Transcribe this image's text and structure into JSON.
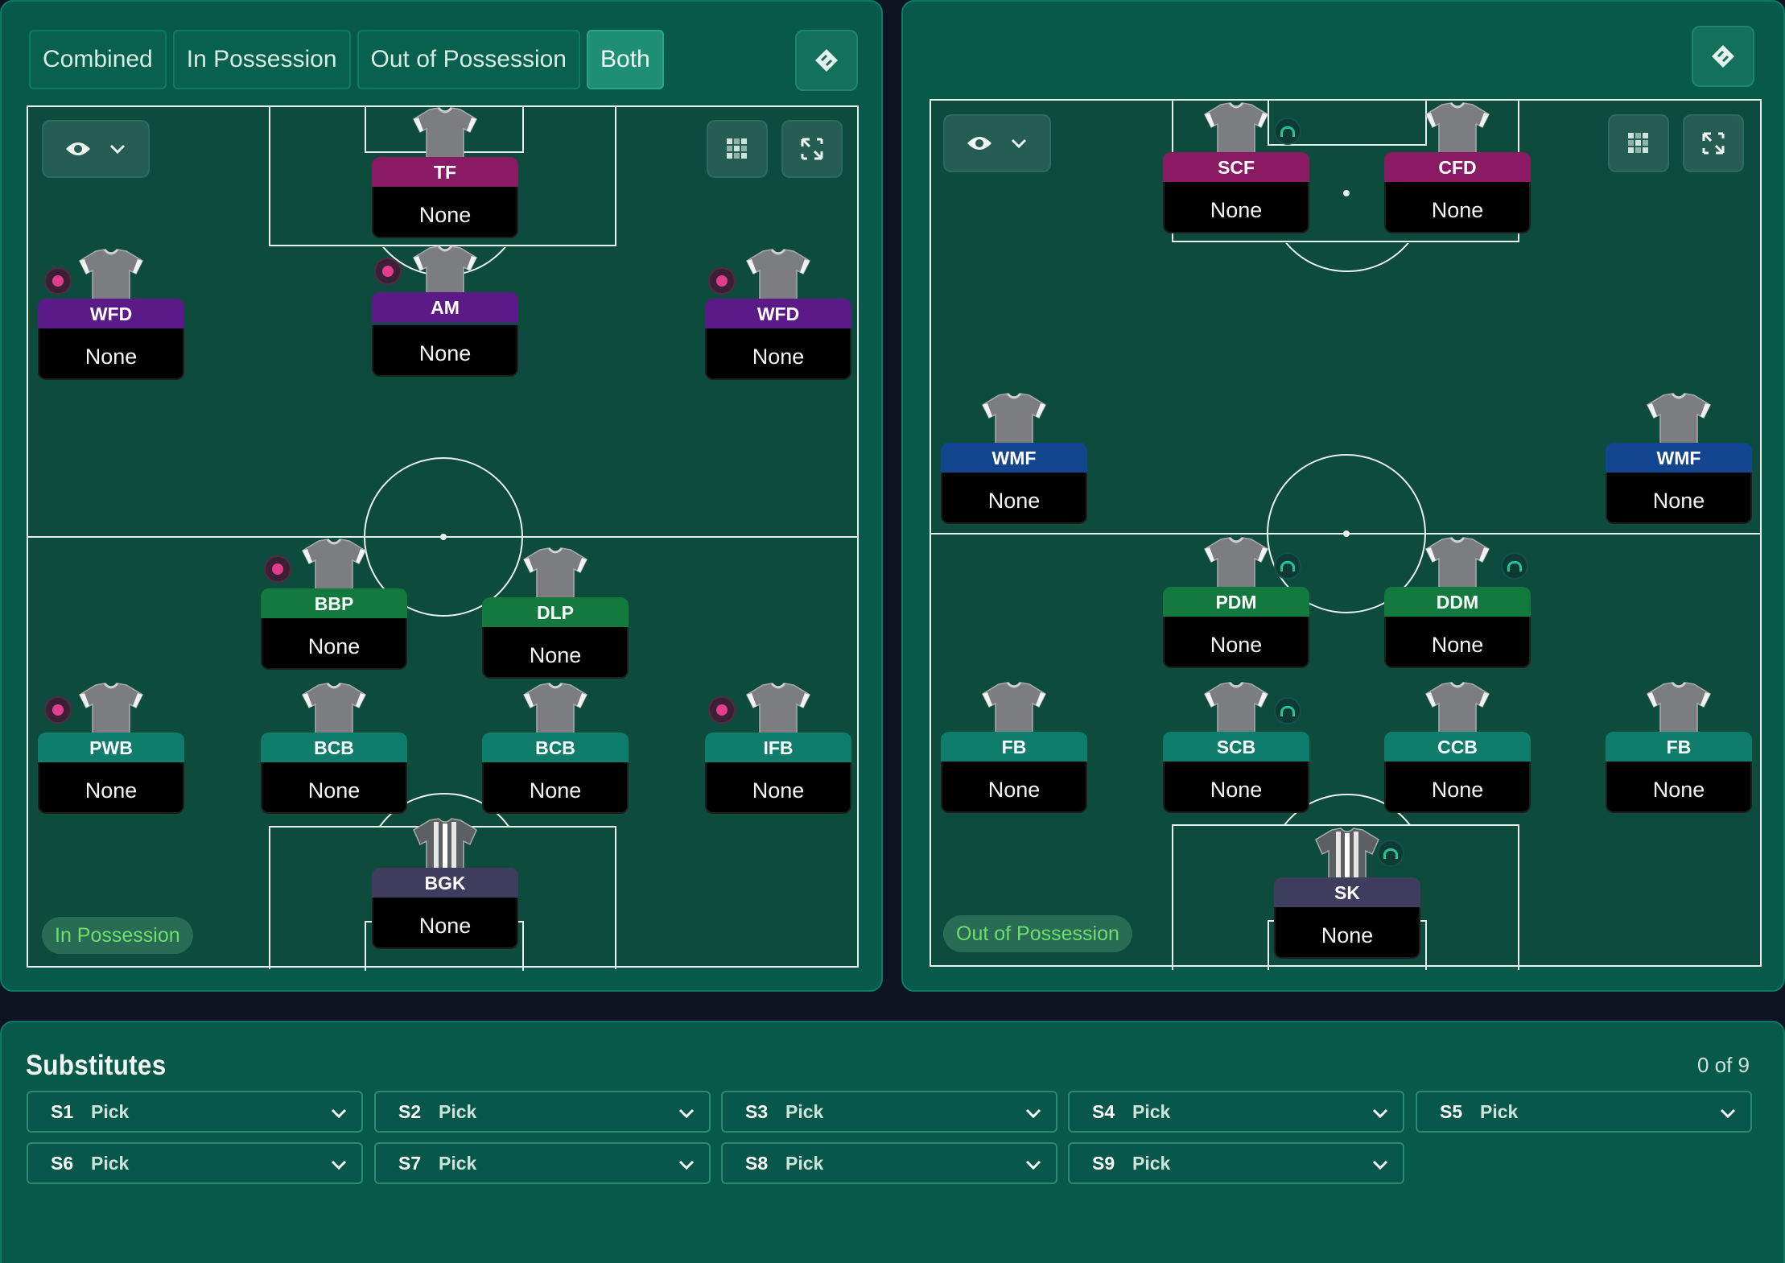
{
  "colors": {
    "panel": "#075a4a",
    "pitch": "#0d4b3d",
    "role_attack": "#8a1a63",
    "role_midfield_attack": "#5c1a88",
    "role_midfield": "#127a3e",
    "role_defence": "#0e7d6c",
    "role_wide_mid": "#12468f",
    "role_gk": "#3e3d5e",
    "accent_green": "#6ddf6a"
  },
  "left_panel": {
    "tabs": [
      {
        "label": "Combined",
        "active": false
      },
      {
        "label": "In Possession",
        "active": false
      },
      {
        "label": "Out of Possession",
        "active": false
      },
      {
        "label": "Both",
        "active": true
      }
    ],
    "mode_label": "In Possession",
    "players": [
      {
        "role": "TF",
        "name": "None",
        "color": "#8a1a63"
      },
      {
        "role": "WFD",
        "name": "None",
        "color": "#5c1a88"
      },
      {
        "role": "AM",
        "name": "None",
        "color": "#5c1a88"
      },
      {
        "role": "WFD",
        "name": "None",
        "color": "#5c1a88"
      },
      {
        "role": "BBP",
        "name": "None",
        "color": "#127a3e"
      },
      {
        "role": "DLP",
        "name": "None",
        "color": "#127a3e"
      },
      {
        "role": "PWB",
        "name": "None",
        "color": "#0e7d6c"
      },
      {
        "role": "BCB",
        "name": "None",
        "color": "#0e7d6c"
      },
      {
        "role": "BCB",
        "name": "None",
        "color": "#0e7d6c"
      },
      {
        "role": "IFB",
        "name": "None",
        "color": "#0e7d6c"
      },
      {
        "role": "BGK",
        "name": "None",
        "color": "#3e3d5e"
      }
    ]
  },
  "right_panel": {
    "mode_label": "Out of Possession",
    "players": [
      {
        "role": "SCF",
        "name": "None",
        "color": "#8a1a63"
      },
      {
        "role": "CFD",
        "name": "None",
        "color": "#8a1a63"
      },
      {
        "role": "WMF",
        "name": "None",
        "color": "#12468f"
      },
      {
        "role": "WMF",
        "name": "None",
        "color": "#12468f"
      },
      {
        "role": "PDM",
        "name": "None",
        "color": "#127a3e"
      },
      {
        "role": "DDM",
        "name": "None",
        "color": "#127a3e"
      },
      {
        "role": "FB",
        "name": "None",
        "color": "#0e7d6c"
      },
      {
        "role": "SCB",
        "name": "None",
        "color": "#0e7d6c"
      },
      {
        "role": "CCB",
        "name": "None",
        "color": "#0e7d6c"
      },
      {
        "role": "FB",
        "name": "None",
        "color": "#0e7d6c"
      },
      {
        "role": "SK",
        "name": "None",
        "color": "#3e3d5e"
      }
    ]
  },
  "substitutes": {
    "title": "Substitutes",
    "count": "0 of 9",
    "slots": [
      {
        "num": "S1",
        "value": "Pick"
      },
      {
        "num": "S2",
        "value": "Pick"
      },
      {
        "num": "S3",
        "value": "Pick"
      },
      {
        "num": "S4",
        "value": "Pick"
      },
      {
        "num": "S5",
        "value": "Pick"
      },
      {
        "num": "S6",
        "value": "Pick"
      },
      {
        "num": "S7",
        "value": "Pick"
      },
      {
        "num": "S8",
        "value": "Pick"
      },
      {
        "num": "S9",
        "value": "Pick"
      }
    ]
  }
}
